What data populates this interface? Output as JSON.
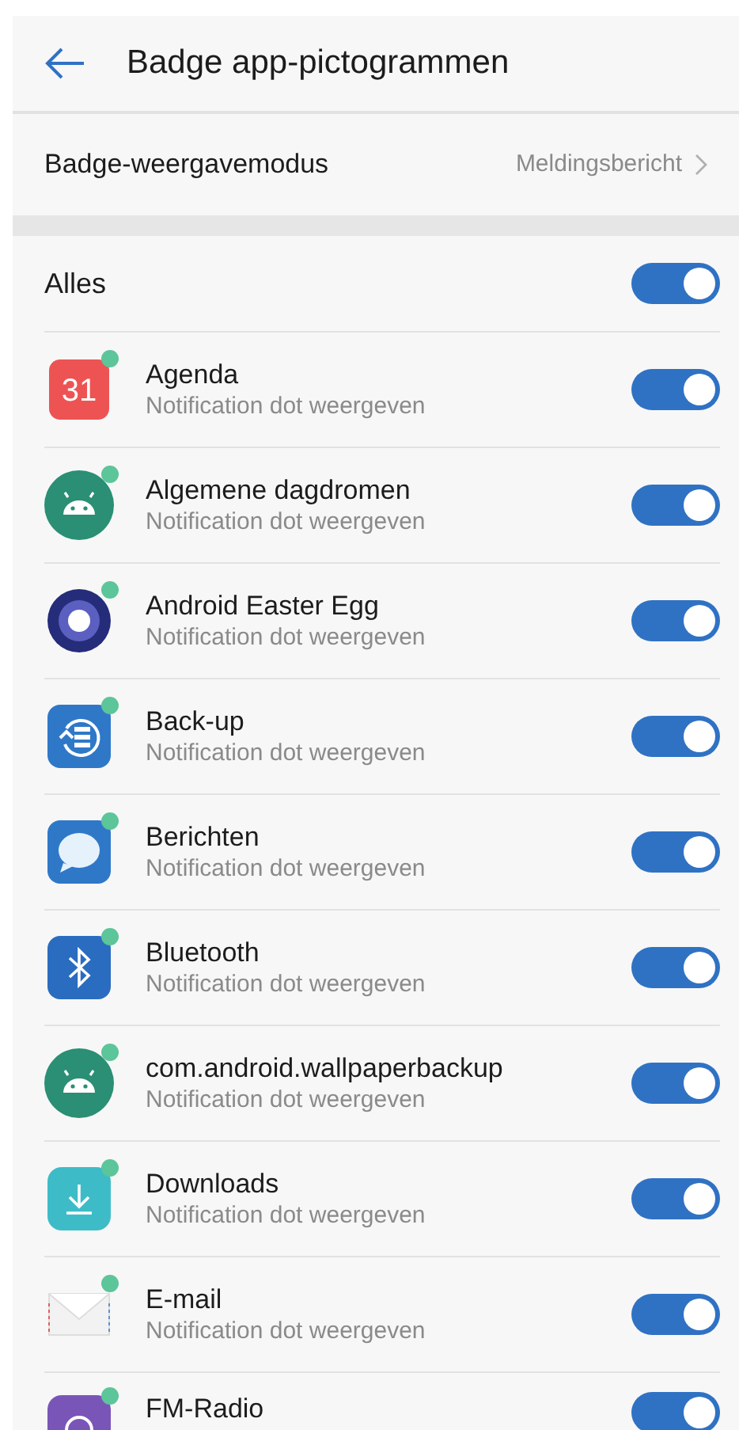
{
  "header": {
    "title": "Badge app-pictogrammen"
  },
  "display_mode": {
    "label": "Badge-weergavemodus",
    "value": "Meldingsbericht"
  },
  "all": {
    "label": "Alles",
    "on": true
  },
  "apps": [
    {
      "kind": "calendar",
      "icon_text": "31",
      "name": "Agenda",
      "subtitle": "Notification dot weergeven",
      "on": true
    },
    {
      "kind": "android",
      "name": "Algemene dagdromen",
      "subtitle": "Notification dot weergeven",
      "on": true
    },
    {
      "kind": "ring",
      "name": "Android Easter Egg",
      "subtitle": "Notification dot weergeven",
      "on": true
    },
    {
      "kind": "backup",
      "name": "Back-up",
      "subtitle": "Notification dot weergeven",
      "on": true
    },
    {
      "kind": "message",
      "name": "Berichten",
      "subtitle": "Notification dot weergeven",
      "on": true
    },
    {
      "kind": "bluetooth",
      "name": "Bluetooth",
      "subtitle": "Notification dot weergeven",
      "on": true
    },
    {
      "kind": "android",
      "name": "com.android.wallpaperbackup",
      "subtitle": "Notification dot weergeven",
      "on": true
    },
    {
      "kind": "download",
      "name": "Downloads",
      "subtitle": "Notification dot weergeven",
      "on": true
    },
    {
      "kind": "mail",
      "name": "E-mail",
      "subtitle": "Notification dot weergeven",
      "on": true
    },
    {
      "kind": "radio",
      "name": "FM-Radio",
      "on": true
    }
  ]
}
